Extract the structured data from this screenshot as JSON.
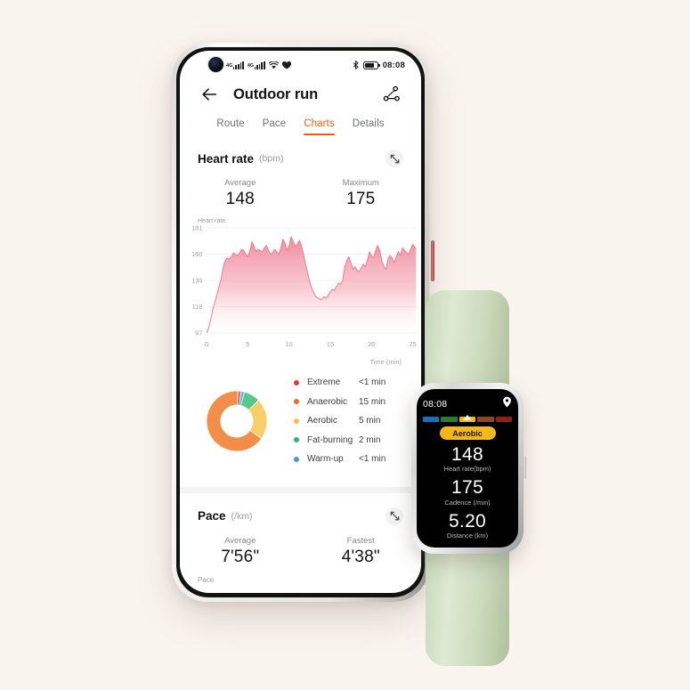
{
  "background_color": "#faf4ef",
  "phone": {
    "statusbar": {
      "network_label_1": "4G",
      "network_label_2": "4G",
      "icons": [
        "punch-hole-camera",
        "signal-icon",
        "signal-icon",
        "wifi-icon",
        "heart-icon",
        "bluetooth-icon",
        "battery-icon"
      ],
      "time": "08:08"
    },
    "header": {
      "back_icon": "back-arrow-icon",
      "title": "Outdoor run",
      "share_icon": "share-nodes-icon"
    },
    "tabs": [
      {
        "label": "Route",
        "active": false
      },
      {
        "label": "Pace",
        "active": false
      },
      {
        "label": "Charts",
        "active": true
      },
      {
        "label": "Details",
        "active": false
      }
    ],
    "accent_color": "#e8620c",
    "heart_rate_card": {
      "title": "Heart rate",
      "unit": "(bpm)",
      "expand_icon": "expand-diagonal-icon",
      "stats": [
        {
          "label": "Average",
          "value": "148"
        },
        {
          "label": "Maximum",
          "value": "175"
        }
      ],
      "chart_axis_title": "Heart rate",
      "zone_legend": [
        {
          "name": "Extreme",
          "value": "<1 min",
          "color": "#e8392c"
        },
        {
          "name": "Anaerobic",
          "value": "15 min",
          "color": "#ed7014"
        },
        {
          "name": "Aerobic",
          "value": "5 min",
          "color": "#f5c23e"
        },
        {
          "name": "Fat-burning",
          "value": "2 min",
          "color": "#27b86e"
        },
        {
          "name": "Warm-up",
          "value": "<1 min",
          "color": "#3d9ae8"
        }
      ]
    },
    "pace_card": {
      "title": "Pace",
      "unit": "(/km)",
      "expand_icon": "expand-diagonal-icon",
      "stats": [
        {
          "label": "Average",
          "value": "7'56\""
        },
        {
          "label": "Fastest",
          "value": "4'38\""
        }
      ],
      "clipped_label": "Pace"
    }
  },
  "watch": {
    "band_color": "#cbdabd",
    "time": "08:08",
    "location_icon": "location-pin-icon",
    "zone_bar_colors": [
      "#1f6fb5",
      "#2f7a33",
      "#f5b719",
      "#8a4a20",
      "#8e2318"
    ],
    "zone_marker_index": 2,
    "zone_pill_label": "Aerobic",
    "zone_pill_color": "#f5b719",
    "metrics": [
      {
        "value": "148",
        "label": "Heart rate(bpm)"
      },
      {
        "value": "175",
        "label": "Cadence (/min)"
      },
      {
        "value": "5.20",
        "label": "Distance (km)"
      }
    ]
  },
  "chart_data": {
    "type": "area",
    "title": "Heart rate",
    "xlabel": "Time (min)",
    "ylabel": "Heart rate",
    "unit": "bpm",
    "xticks": [
      0,
      5,
      10,
      15,
      20,
      25
    ],
    "yticks": [
      97,
      118,
      139,
      160,
      181
    ],
    "xlim": [
      0,
      25.6
    ],
    "ylim": [
      97,
      181
    ],
    "grid": true,
    "line_color": "#ef7a8e",
    "fill_gradient": [
      "#f0859a",
      "#ffffff"
    ],
    "series": [
      {
        "name": "Heart rate",
        "x": [
          0.0,
          0.25,
          0.5,
          0.75,
          1.0,
          1.25,
          1.5,
          1.75,
          2.0,
          2.25,
          2.5,
          2.75,
          3.0,
          3.25,
          3.5,
          3.75,
          4.0,
          4.25,
          4.5,
          4.75,
          5.0,
          5.25,
          5.5,
          5.75,
          6.0,
          6.25,
          6.5,
          6.75,
          7.0,
          7.25,
          7.5,
          7.75,
          8.0,
          8.25,
          8.5,
          8.75,
          9.0,
          9.25,
          9.5,
          9.75,
          10.0,
          10.25,
          10.5,
          10.75,
          11.0,
          11.25,
          11.5,
          11.75,
          12.0,
          12.25,
          12.5,
          12.75,
          13.0,
          13.25,
          13.5,
          13.75,
          14.0,
          14.25,
          14.5,
          14.75,
          15.0,
          15.25,
          15.5,
          15.75,
          16.0,
          16.25,
          16.5,
          16.75,
          17.0,
          17.25,
          17.5,
          17.75,
          18.0,
          18.25,
          18.5,
          18.75,
          19.0,
          19.25,
          19.5,
          19.75,
          20.0,
          20.25,
          20.5,
          20.75,
          21.0,
          21.25,
          21.5,
          21.75,
          22.0,
          22.25,
          22.5,
          22.75,
          23.0,
          23.25,
          23.5,
          23.75,
          24.0,
          24.5,
          25.0,
          25.4
        ],
        "y": [
          97,
          101,
          108,
          116,
          122,
          128,
          134,
          140,
          149,
          155,
          157,
          156,
          158,
          161,
          160,
          159,
          161,
          164,
          163,
          160,
          158,
          163,
          170,
          166,
          162,
          164,
          163,
          162,
          165,
          167,
          163,
          160,
          161,
          164,
          162,
          160,
          165,
          172,
          169,
          163,
          167,
          174,
          170,
          166,
          168,
          171,
          167,
          160,
          152,
          145,
          138,
          133,
          129,
          126,
          125,
          124,
          124,
          126,
          125,
          127,
          130,
          132,
          131,
          134,
          137,
          136,
          139,
          150,
          155,
          158,
          153,
          148,
          150,
          147,
          146,
          149,
          152,
          150,
          155,
          162,
          159,
          157,
          163,
          167,
          163,
          155,
          150,
          148,
          156,
          159,
          157,
          153,
          158,
          162,
          159,
          165,
          163,
          160,
          168,
          164
        ]
      }
    ]
  }
}
